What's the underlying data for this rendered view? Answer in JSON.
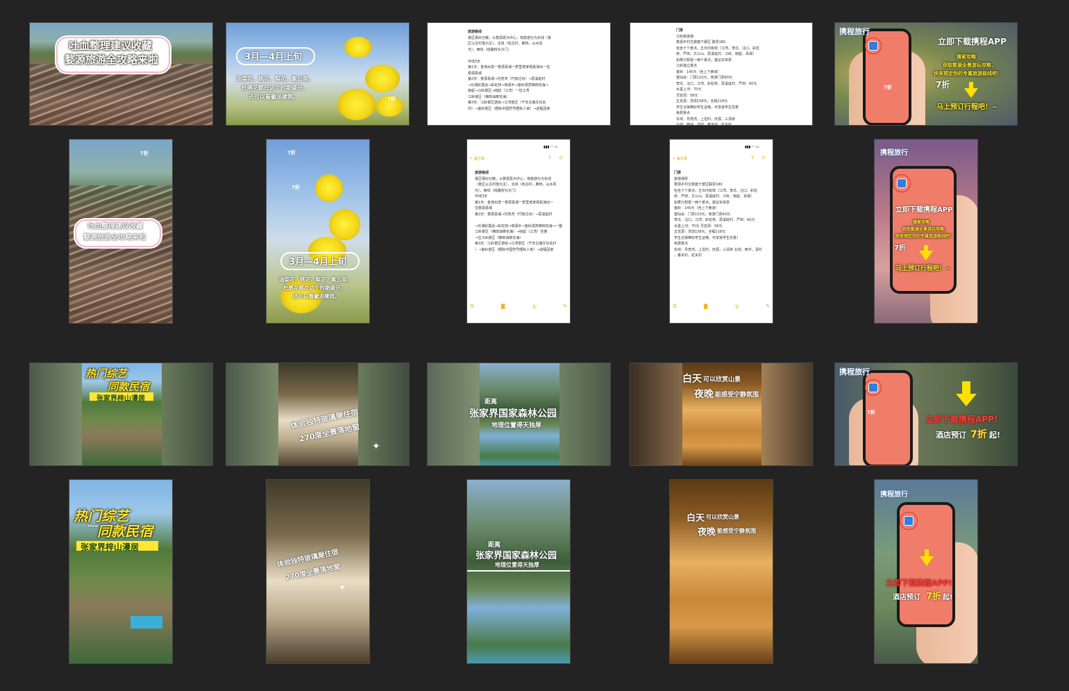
{
  "row1": {
    "t1": {
      "title1": "吐血整理建议收藏",
      "title2": "婺源旅游全攻略来啦"
    },
    "t2": {
      "heading": "3月—4月上旬",
      "body1": "油菜花，桃花，梨花，紫云英，",
      "body2": "杜鹃花都在这个时期盛开，",
      "body3": "还可以看徽派建筑。",
      "badge": "7折"
    },
    "t3": {
      "lines": [
        "旅游路线",
        "景区相对分散，以婺源县为中心，将旅游分为东线（景",
        "区以古村落为主），北线（有古村，廊桥，山水风",
        "光），西线（线路较为冷门）",
        "",
        "环线3天",
        "第1天：各地出发一婺源县城一梦里老家观看演出一住",
        "婺源县城",
        "第2天：婺源县城→月亮湾（竹筏泛舟）→思溪延村",
        "→长滩彩霞谷→彩虹桥→晓源乡→篁岭观赏梯田花海→",
        "晓起→江岭景区→晓起（江湾）一住江湾",
        "江岭景区（梯田油菜花海）",
        "第3天：江岭景区游玩→江湾景区（千年古镇文化名",
        "村）→篁岭景区（晒秋中国符号晒秋人家）→返程回家"
      ]
    },
    "t4": {
      "lines": [
        "门票",
        "江岭旅游通",
        "婺源乡村文旅旗下景区 联票180",
        "包含十个景点，五日内有效（江湾、李坑、汪口、彩虹",
        "桥、严田、文公山、思溪延村、江岭、晓起、百城）",
        "如果只想逛一两个景点，建议买单票",
        "江岭独立景点",
        "篁岭：145元（含上下索道）",
        "望仙谷：门票110元，夜游门票60元",
        "李坑、汪口、江湾、彩虹桥、思溪延村、严田：60元",
        "水墨上河：70元",
        "灵岩洞：58元",
        "五龙源：漂流158元，全程218元",
        "学生记得带好学生证哦，可享受学生优惠",
        "免费景点",
        "东线：月亮湾，上坦村，庆源，三清桥",
        "北线：西冲，凛村，秦关村，虹关村"
      ]
    },
    "t5": {
      "logo": "携程旅行",
      "headline": "立即下载携程APP",
      "sub1": "搜索攻略",
      "sub2": "获取婺源全景游玩攻略，",
      "sub3": "快来预定你的专属旅游路线吧！",
      "badge": "7折",
      "cta": "马上预订行程吧！~",
      "phone_badge": "7折"
    }
  },
  "row2": {
    "t1": {
      "title1": "吐血整理建议收藏",
      "title2": "婺源旅游全攻略来啦",
      "badge": "7折"
    },
    "t2": {
      "badge_top": "7折",
      "badge_mid": "7折",
      "heading": "3月—4月上旬",
      "body1": "油菜花，桃花，梨花，紫云英，",
      "body2": "杜鹃花都在这个时期盛开，",
      "body3": "还可以看徽派建筑。"
    },
    "t3": {
      "back": "备忘录",
      "lines": [
        "旅游路线",
        "景区相对分散，以婺源县为中心，将旅游分为东线",
        "（景区以古村落为主），北线（有古村，廊桥，山水风",
        "光），西线（线路较为冷门）",
        "环线3天",
        "第1天：各地出发一婺源县城一梦里老家观看演出一",
        "住婺源县城",
        "第2天：婺源县城→月亮湾（竹筏泛舟）→思溪延村",
        "",
        "→长滩彩霞谷→彩虹桥→晓源乡→篁岭观赏梯田花海→一整",
        "江岭景区（梯田油菜花海）→晓起（江湾）住宿 ",
        "→住江岭景区（梯田油菜花海）",
        "第3天：江岭景区游玩→江湾景区（千年古镇文化名村",
        "）→篁岭景区（晒秋中国符号晒秋人家）→返程回家"
      ]
    },
    "t4": {
      "back": "备忘录",
      "lines": [
        "门票",
        "旅游通票",
        "婺源乡村文旅旗下景区联票180",
        "包含十个景点，五日内有效（江湾、李坑、汪口、彩虹",
        "桥、严田、文公山、思溪延村、江岭、晓起、百城）",
        "如果只想逛一两个景点，建议买单票",
        "篁岭：145元（含上下索道）",
        "望仙谷：门票110元，夜游门票60元",
        "李坑、汪口、江湾、彩虹桥、思溪延村、严田：60元",
        "水墨上河：70元 灵岩洞：58元",
        "五龙源：漂流158元，全程218元",
        "学生记得带好学生证哦，可享受学生优惠！",
        "免费景点",
        "东线：月亮湾，上坦村，庆源，三清桥 北线：西冲，凛村",
        "，秦关村，虹关村"
      ]
    },
    "t5": {
      "logo": "携程旅行",
      "headline": "立即下载携程APP",
      "sub1": "搜索攻略",
      "sub2": "获取婺源全景游玩攻略，",
      "sub3": "快来预定你的专属旅游路线吧！",
      "badge": "7折",
      "cta": "马上预订行程吧！~"
    }
  },
  "row3": {
    "t1": {
      "title1": "热门综艺",
      "title2": "同款民宿",
      "sub": "张家界梓山漫居",
      "small": "Show"
    },
    "t2": {
      "line1": "体验独特玻璃屋住宿",
      "line2": "270度全景落地窗"
    },
    "t3": {
      "prefix": "距离",
      "title": "张家界国家森林公园",
      "sub": "地理位置得天独厚"
    },
    "t4": {
      "line1a": "白天",
      "line1b": "可以欣赏山景",
      "line2a": "夜晚",
      "line2b": "能感受宁静氛围"
    },
    "t5": {
      "logo": "携程旅行",
      "headline": "立即下载携程APP!",
      "sub": "酒店预订",
      "discount": "7折",
      "suffix": "起!",
      "phone_badge": "7折"
    }
  },
  "row4": {
    "t1": {
      "title1": "热门综艺",
      "title2": "同款民宿",
      "sub": "张家界梓山漫居",
      "small": "Show"
    },
    "t2": {
      "line1": "体验独特玻璃屋住宿",
      "line2": "270度全景落地窗"
    },
    "t3": {
      "prefix": "距离",
      "title": "张家界国家森林公园",
      "sub": "地理位置得天独厚"
    },
    "t4": {
      "line1a": "白天",
      "line1b": "可以欣赏山景",
      "line2a": "夜晚",
      "line2b": "能感受宁静氛围"
    },
    "t5": {
      "logo": "携程旅行",
      "headline": "立即下载携程APP!",
      "sub": "酒店预订",
      "discount": "7折",
      "suffix": "起!"
    }
  },
  "colors": {
    "background": "#232323",
    "promo_yellow": "#ffe733",
    "promo_red": "#ff3b3b",
    "phone_screen": "#ef7d6a",
    "ctrip_blue": "#2f7ee0"
  }
}
